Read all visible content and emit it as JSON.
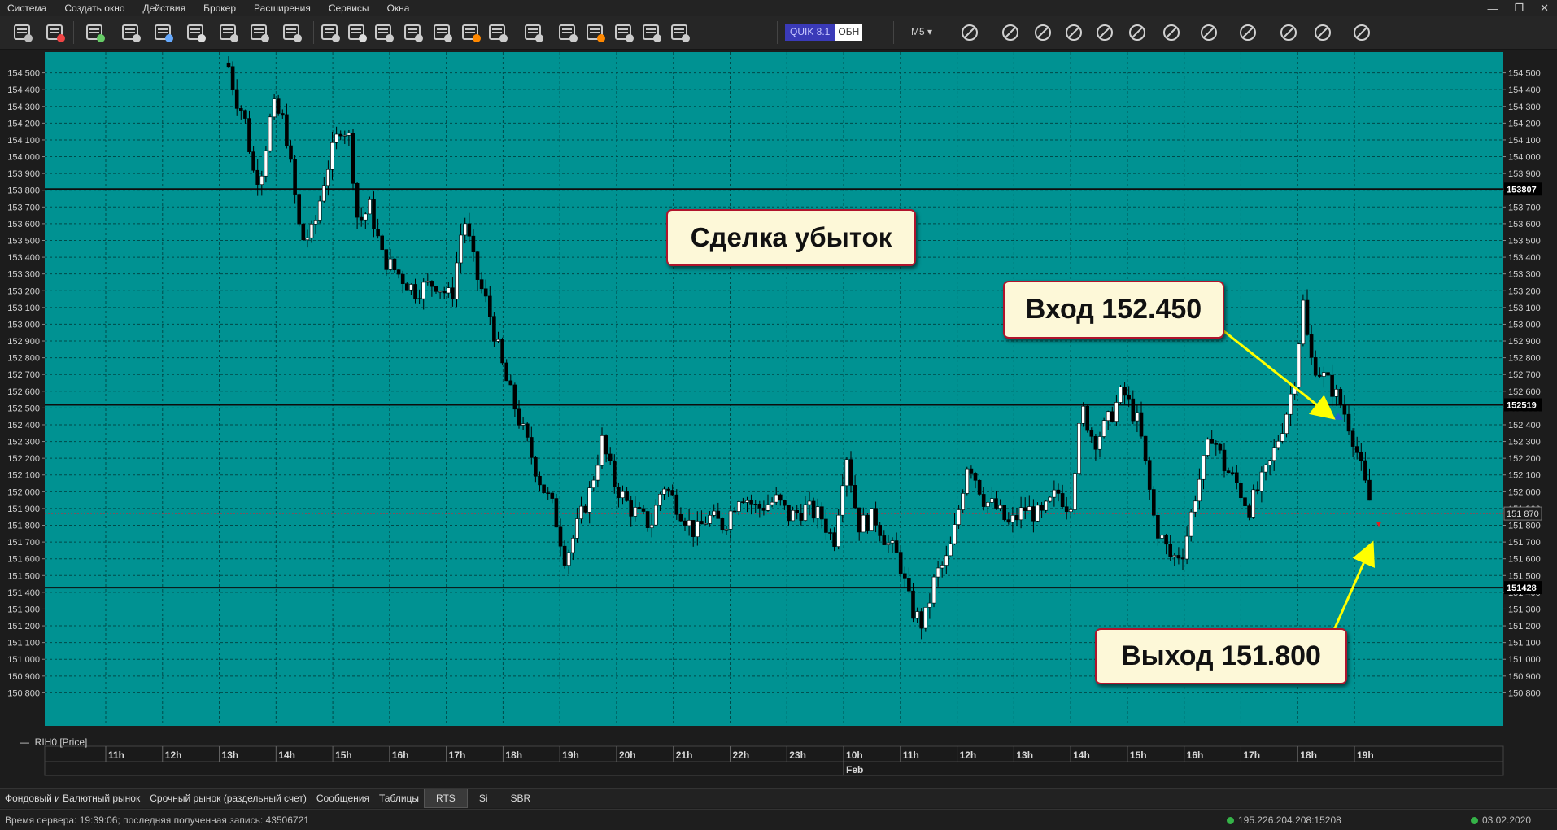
{
  "menu": [
    "Система",
    "Создать окно",
    "Действия",
    "Брокер",
    "Расширения",
    "Сервисы",
    "Окна"
  ],
  "window_controls": {
    "minimize": "—",
    "restore": "❐",
    "close": "✕"
  },
  "toolbar": {
    "icons": [
      "settings-wrench-icon",
      "disconnect-icon",
      "new-window-icon",
      "chart-icon",
      "quotes-icon",
      "table-icon",
      "orders-icon",
      "portfolio-settings-icon",
      "stop-orders-icon",
      "trades-icon",
      "messages-icon",
      "alerts-icon",
      "hand-icon",
      "limits-icon",
      "money-icon",
      "clients-icon",
      "positions-icon",
      "deals-icon",
      "transfers-icon",
      "balance-icon",
      "briefcase-icon",
      "money-bag-icon"
    ],
    "terminal_label": "QUIK 8.1",
    "mode_label": "ОБН",
    "timeframe": "M5",
    "chart_tools": [
      "crosshair-icon",
      "fit-icon",
      "zoom-in-icon",
      "zoom-out-icon",
      "ruler-icon",
      "target-icon",
      "pan-hand-icon",
      "line-tool-icon",
      "text-tool-icon",
      "fill-tool-icon",
      "hide-icon",
      "grid-tool-icon"
    ]
  },
  "chart_data": {
    "type": "candlestick",
    "instrument": "RIH0 [Price]",
    "y_range": [
      150700,
      154600
    ],
    "y_ticks": [
      154500,
      154400,
      154300,
      154200,
      154100,
      154000,
      153900,
      153800,
      153700,
      153600,
      153500,
      153400,
      153300,
      153200,
      153100,
      153000,
      152900,
      152800,
      152700,
      152600,
      152500,
      152400,
      152300,
      152200,
      152100,
      152000,
      151900,
      151800,
      151700,
      151600,
      151500,
      151400,
      151300,
      151200,
      151100,
      151000,
      150900,
      150800
    ],
    "x_ticks": [
      "11h",
      "12h",
      "13h",
      "14h",
      "15h",
      "16h",
      "17h",
      "18h",
      "19h",
      "20h",
      "21h",
      "22h",
      "23h",
      "10h",
      "11h",
      "12h",
      "13h",
      "14h",
      "15h",
      "16h",
      "17h",
      "18h",
      "19h"
    ],
    "date_label": "Feb",
    "horizontal_levels": [
      {
        "value": 153807,
        "label": "153807"
      },
      {
        "value": 152519,
        "label": "152519"
      },
      {
        "value": 151428,
        "label": "151428"
      }
    ],
    "current_price": {
      "value": 151870,
      "label": "151 870"
    },
    "annotations": [
      {
        "text": "Сделка убыток"
      },
      {
        "text": "Вход 152.450"
      },
      {
        "text": "Выход 151.800"
      }
    ],
    "colors": {
      "background": "#009292",
      "grid": "#004a4a",
      "candle_up": "#ffffff",
      "candle_down": "#000000",
      "arrow": "#ffff00",
      "callout_border": "#b0142c",
      "callout_bg": "#fdf8d8"
    }
  },
  "legend": "RIH0 [Price]",
  "tabs": [
    "Фондовый и Валютный рынок",
    "Срочный рынок (раздельный счет)",
    "Сообщения",
    "Таблицы",
    "RTS",
    "Si",
    "SBR"
  ],
  "active_tab": "RTS",
  "status": {
    "server_time": "Время сервера: 19:39:06; последняя полученная запись: 43506721",
    "address": "195.226.204.208:15208",
    "date": "03.02.2020"
  }
}
